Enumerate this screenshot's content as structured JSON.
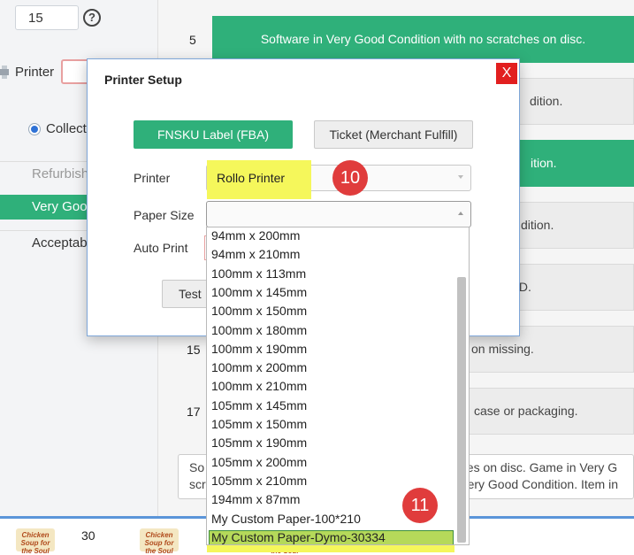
{
  "sidebar": {
    "quantity_value": "15",
    "help_glyph": "?",
    "printer_label": "Printer",
    "collect_label": "Collect",
    "conditions": [
      "Refurbish",
      "Very Goo",
      "Acceptab"
    ]
  },
  "main": {
    "row_numbers": [
      "5",
      "15",
      "17"
    ],
    "top_row_text": "Software in Very Good Condition with no scratches on disc.",
    "row_fragments": [
      "dition.",
      "ition.",
      "dition.",
      "TED.",
      "on missing.",
      "case or packaging."
    ],
    "notes_line1_left": "So",
    "notes_line1_right": "hes on disc. Game in Very G",
    "notes_line2_left": "scr",
    "notes_line2_right": "Very Good Condition. Item in"
  },
  "bottom": {
    "row_number": "30",
    "logo_text": "Chicken Soup for the Soul"
  },
  "dialog": {
    "title": "Printer Setup",
    "close_label": "X",
    "tab_fnsku_label": "FNSKU Label (FBA)",
    "tab_ticket_label": "Ticket (Merchant Fulfill)",
    "printer_label": "Printer",
    "printer_value": "Rollo Printer",
    "paper_size_label": "Paper Size",
    "auto_print_label": "Auto Print",
    "test_label": "Test",
    "badge_printer": "10",
    "badge_custom": "11"
  },
  "paper_options": [
    "94mm x 200mm",
    "94mm x 210mm",
    "100mm x 113mm",
    "100mm x 145mm",
    "100mm x 150mm",
    "100mm x 180mm",
    "100mm x 190mm",
    "100mm x 200mm",
    "100mm x 210mm",
    "105mm x 145mm",
    "105mm x 150mm",
    "105mm x 190mm",
    "105mm x 200mm",
    "105mm x 210mm",
    "194mm x 87mm",
    "My Custom Paper-100*210",
    "My Custom Paper-Dymo-30334"
  ],
  "selected_paper": "My Custom Paper-Dymo-30334",
  "colors": {
    "accent_green": "#2fb07a",
    "highlight_yellow": "#f5f75b",
    "selected_option": "#b5d95a",
    "badge_red": "#e03c3c",
    "close_red": "#e21f1f"
  }
}
